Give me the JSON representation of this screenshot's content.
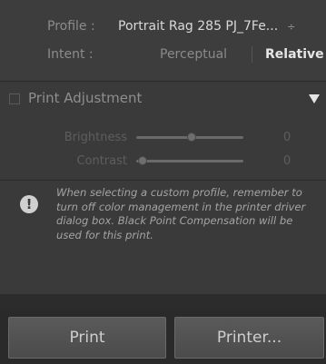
{
  "color_management": {
    "profile_label": "Profile :",
    "profile_value": "Portrait Rag 285 PJ_7Fe...",
    "profile_arrow": "÷",
    "intent_label": "Intent :",
    "intent_options": [
      "Perceptual",
      "Relative"
    ],
    "intent_selected": "Relative"
  },
  "print_adjustment": {
    "title": "Print Adjustment",
    "enabled": false,
    "brightness": {
      "label": "Brightness",
      "value": "0"
    },
    "contrast": {
      "label": "Contrast",
      "value": "0"
    }
  },
  "notice": {
    "text": "When selecting a custom profile, remember to turn off color management in the printer driver dialog box. Black Point Compensation will be used for this print."
  },
  "buttons": {
    "print": "Print",
    "printer": "Printer..."
  },
  "colors": {
    "panel_bg": "#3a3a3a",
    "button_bg": "#505050",
    "text_highlight": "#e6e6e6"
  }
}
